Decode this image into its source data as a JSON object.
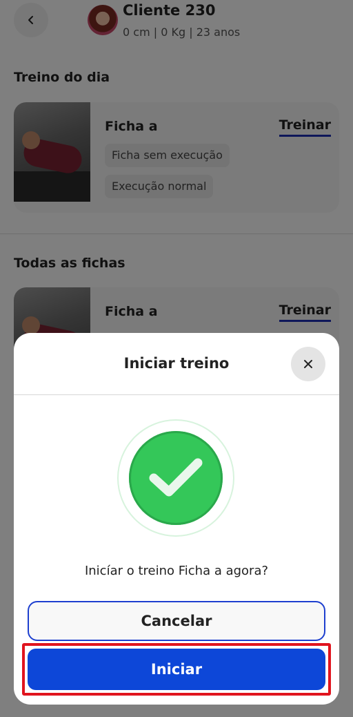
{
  "header": {
    "client_name": "Cliente 230",
    "client_info": "0 cm | 0 Kg | 23 anos"
  },
  "today": {
    "section_title": "Treino do dia",
    "card": {
      "title": "Ficha a",
      "action": "Treinar",
      "tags": [
        "Ficha sem execução",
        "Execução normal"
      ]
    }
  },
  "all": {
    "section_title": "Todas as fichas",
    "card": {
      "title": "Ficha a",
      "action": "Treinar"
    }
  },
  "modal": {
    "title": "Iniciar treino",
    "question": "Inicíar o treino Ficha a agora?",
    "cancel_label": "Cancelar",
    "start_label": "Iniciar"
  },
  "colors": {
    "primary": "#0d47d8",
    "success": "#34c759",
    "highlight": "#e0141e"
  }
}
